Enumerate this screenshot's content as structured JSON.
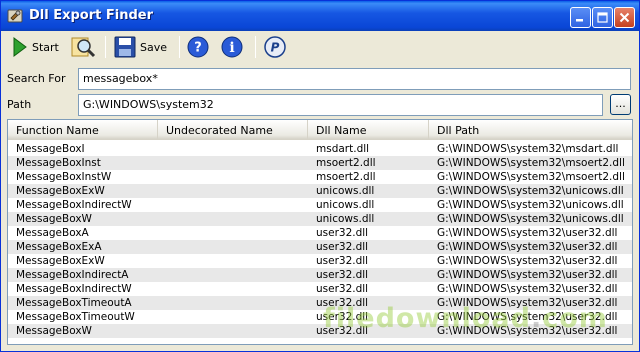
{
  "window": {
    "title": "Dll Export Finder"
  },
  "toolbar": {
    "start_label": "Start",
    "save_label": "Save"
  },
  "search": {
    "label": "Search For",
    "value": "messagebox*"
  },
  "path": {
    "label": "Path",
    "value": "G:\\WINDOWS\\system32",
    "browse_label": "..."
  },
  "table": {
    "columns": [
      "Function Name",
      "Undecorated Name",
      "Dll Name",
      "Dll Path"
    ],
    "rows": [
      [
        "MessageBoxI",
        "",
        "msdart.dll",
        "G:\\WINDOWS\\system32\\msdart.dll"
      ],
      [
        "MessageBoxInst",
        "",
        "msoert2.dll",
        "G:\\WINDOWS\\system32\\msoert2.dll"
      ],
      [
        "MessageBoxInstW",
        "",
        "msoert2.dll",
        "G:\\WINDOWS\\system32\\msoert2.dll"
      ],
      [
        "MessageBoxExW",
        "",
        "unicows.dll",
        "G:\\WINDOWS\\system32\\unicows.dll"
      ],
      [
        "MessageBoxIndirectW",
        "",
        "unicows.dll",
        "G:\\WINDOWS\\system32\\unicows.dll"
      ],
      [
        "MessageBoxW",
        "",
        "unicows.dll",
        "G:\\WINDOWS\\system32\\unicows.dll"
      ],
      [
        "MessageBoxA",
        "",
        "user32.dll",
        "G:\\WINDOWS\\system32\\user32.dll"
      ],
      [
        "MessageBoxExA",
        "",
        "user32.dll",
        "G:\\WINDOWS\\system32\\user32.dll"
      ],
      [
        "MessageBoxExW",
        "",
        "user32.dll",
        "G:\\WINDOWS\\system32\\user32.dll"
      ],
      [
        "MessageBoxIndirectA",
        "",
        "user32.dll",
        "G:\\WINDOWS\\system32\\user32.dll"
      ],
      [
        "MessageBoxIndirectW",
        "",
        "user32.dll",
        "G:\\WINDOWS\\system32\\user32.dll"
      ],
      [
        "MessageBoxTimeoutA",
        "",
        "user32.dll",
        "G:\\WINDOWS\\system32\\user32.dll"
      ],
      [
        "MessageBoxTimeoutW",
        "",
        "user32.dll",
        "G:\\WINDOWS\\system32\\user32.dll"
      ],
      [
        "MessageBoxW",
        "",
        "user32.dll",
        "G:\\WINDOWS\\system32\\user32.dll"
      ]
    ]
  },
  "watermark": {
    "text_a": "filedownload",
    "text_dot": ".",
    "text_b": "com"
  },
  "icons": {
    "app": "app-tool-icon",
    "start": "play-icon",
    "search": "magnifier-icon",
    "save": "floppy-icon",
    "help": "help-icon",
    "info": "info-icon",
    "paypal": "paypal-icon"
  },
  "colors": {
    "title_bar": "#0a46d6",
    "window_bg": "#ece9d8",
    "alt_row": "#e8e8e8",
    "field_border": "#7f9db9"
  }
}
